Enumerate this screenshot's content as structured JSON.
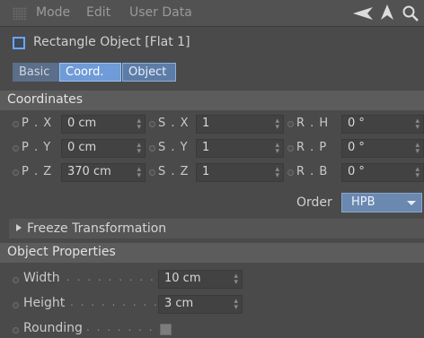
{
  "menubar": {
    "items": [
      "Mode",
      "Edit",
      "User Data"
    ],
    "icons": [
      "grip-icon",
      "back-arrow-icon",
      "up-arrow-icon",
      "search-icon"
    ]
  },
  "object": {
    "title": "Rectangle Object [Flat 1]",
    "checked": false
  },
  "tabs": [
    "Basic",
    "Coord.",
    "Object"
  ],
  "active_tab": "Coord.",
  "coordinates": {
    "header": "Coordinates",
    "rows": [
      {
        "p_label": "P . X",
        "p_value": "0 cm",
        "s_label": "S . X",
        "s_value": "1",
        "r_label": "R . H",
        "r_value": "0 °"
      },
      {
        "p_label": "P . Y",
        "p_value": "0 cm",
        "s_label": "S . Y",
        "s_value": "1",
        "r_label": "R . P",
        "r_value": "0 °"
      },
      {
        "p_label": "P . Z",
        "p_value": "370 cm",
        "s_label": "S . Z",
        "s_value": "1",
        "r_label": "R . B",
        "r_value": "0 °"
      }
    ],
    "order_label": "Order",
    "order_value": "HPB",
    "freeze": "Freeze Transformation"
  },
  "object_properties": {
    "header": "Object Properties",
    "width_label": "Width",
    "width_dots": ". . . . . . . . . . .",
    "width_value": "10 cm",
    "height_label": "Height",
    "height_dots": ". . . . . . . . . . .",
    "height_value": "3 cm",
    "rounding_label": "Rounding",
    "rounding_dots": ". . . . . . . .",
    "rounding_checked": false
  },
  "colors": {
    "panel_bg": "#4a4a4a",
    "active_tab": "#6f9bd8",
    "accent_blue": "#6aa6ff"
  }
}
